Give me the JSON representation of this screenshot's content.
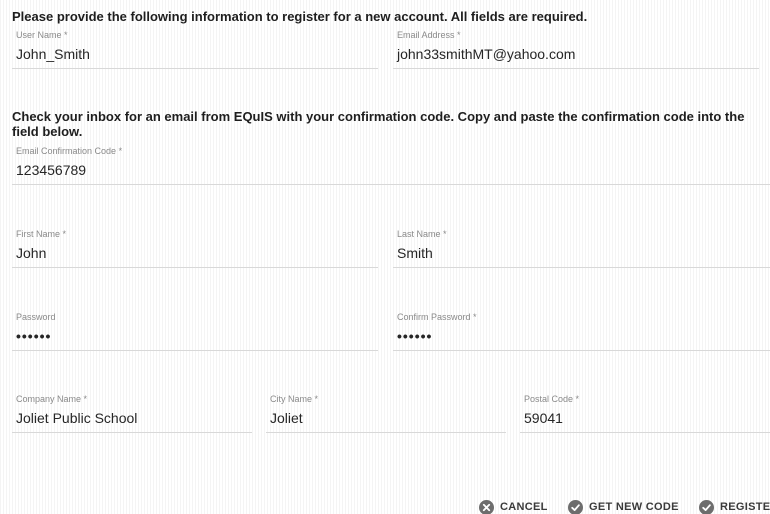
{
  "instructions": {
    "account": "Please provide the following information to register for a new account. All fields are required.",
    "confirmation": "Check your inbox for an email from EQuIS with your confirmation code. Copy and paste the confirmation code into the field below."
  },
  "fields": {
    "user_name": {
      "label": "User Name",
      "value": "John_Smith"
    },
    "email": {
      "label": "Email Address",
      "value": "john33smithMT@yahoo.com"
    },
    "confirmation_code": {
      "label": "Email Confirmation Code",
      "value": "123456789"
    },
    "first_name": {
      "label": "First Name",
      "value": "John"
    },
    "last_name": {
      "label": "Last Name",
      "value": "Smith"
    },
    "password": {
      "label": "Password",
      "value": "••••••"
    },
    "confirm_password": {
      "label": "Confirm Password",
      "value": "••••••"
    },
    "company_name": {
      "label": "Company Name",
      "value": "Joliet Public School"
    },
    "city_name": {
      "label": "City Name",
      "value": "Joliet"
    },
    "postal_code": {
      "label": "Postal Code",
      "value": "59041"
    }
  },
  "required_marker": "*",
  "buttons": {
    "cancel": {
      "label": "CANCEL",
      "icon": "close-circle-icon"
    },
    "get_new_code": {
      "label": "GET NEW CODE",
      "icon": "check-circle-icon"
    },
    "register": {
      "label": "REGISTE",
      "icon": "check-circle-icon"
    }
  },
  "colors": {
    "text": "#222222",
    "label": "#8a8a8a",
    "icon": "#6d6d6d",
    "divider": "#d8d8d8"
  }
}
